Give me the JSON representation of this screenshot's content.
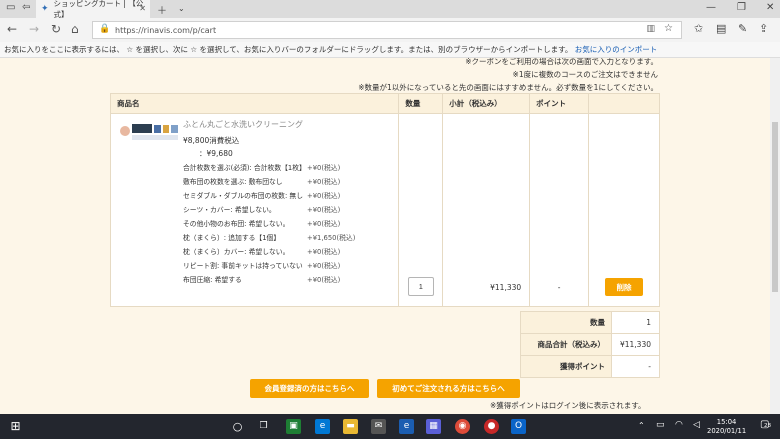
{
  "tab": {
    "title": "ショッピングカート | 【公式】"
  },
  "address": {
    "url": "https://rinavis.com/p/cart"
  },
  "favbar": {
    "text": "お気に入りをここに表示するには、 ☆ を選択し、次に ☆ を選択して、お気に入りバーのフォルダーにドラッグします。または、別のブラウザーからインポートします。",
    "link": "お気に入りのインポート"
  },
  "notes": [
    "※クーポンをご利用の場合は次の画面で入力となります。",
    "※1度に複数のコースのご注文はできません",
    "※数量が1以外になっていると先の画面にはすすめません。必ず数量を1にしてください。"
  ],
  "table": {
    "headers": [
      "商品名",
      "数量",
      "小計（税込み）",
      "ポイント",
      ""
    ],
    "product": {
      "name": "ふとん丸ごと水洗いクリーニング",
      "price": "¥8,800消費税込",
      "price2": "：¥9,680",
      "options": [
        {
          "label": "合計枚数を選ぶ(必須): 合計枚数【1枚】",
          "price": "+¥0(税込)"
        },
        {
          "label": "敷布団の枚数を選ぶ: 敷布団なし",
          "price": "+¥0(税込)"
        },
        {
          "label": "セミダブル・ダブルの布団の枚数: 無し",
          "price": "+¥0(税込)"
        },
        {
          "label": "シーツ・カバー: 希望しない。",
          "price": "+¥0(税込)"
        },
        {
          "label": "その他小物のお布団: 希望しない。",
          "price": "+¥0(税込)"
        },
        {
          "label": "枕（まくら）: 追加する【1個】",
          "price": "+¥1,650(税込)"
        },
        {
          "label": "枕（まくら）カバー: 希望しない。",
          "price": "+¥0(税込)"
        },
        {
          "label": "リピート割: 事前キットは持っていない",
          "price": "+¥0(税込)"
        },
        {
          "label": "布団圧縮: 希望する",
          "price": "+¥0(税込)"
        }
      ],
      "quantity": "1",
      "subtotal": "¥11,330",
      "points": "-",
      "delete": "削除"
    }
  },
  "summary": [
    {
      "label": "数量",
      "value": "1"
    },
    {
      "label": "商品合計（税込み）",
      "value": "¥11,330"
    },
    {
      "label": "獲得ポイント",
      "value": "-"
    }
  ],
  "buttons": {
    "member": "会員登録済の方はこちらへ",
    "first": "初めてご注文される方はこちらへ"
  },
  "footnote": "※獲得ポイントはログイン後に表示されます。",
  "clock": {
    "time": "15:04",
    "date": "2020/01/11"
  },
  "notif": "28"
}
